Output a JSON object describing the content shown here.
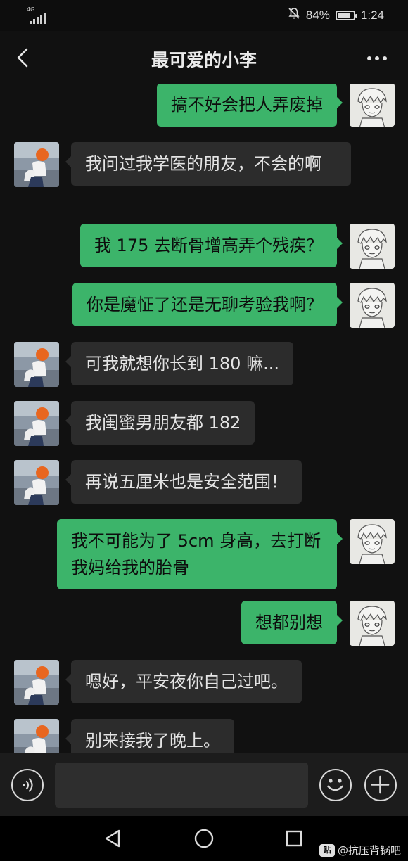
{
  "status_bar": {
    "network": "4G",
    "battery": "84%",
    "battery_level": 0.84,
    "time": "1:24"
  },
  "header": {
    "title": "最可爱的小李"
  },
  "messages": [
    {
      "side": "right",
      "text": "搞不好会把人弄废掉"
    },
    {
      "side": "left",
      "text": "我问过我学医的朋友，不会的啊"
    },
    {
      "side": "right",
      "text": "我 175 去断骨增高弄个残疾？"
    },
    {
      "side": "right",
      "text": "你是魔怔了还是无聊考验我啊？"
    },
    {
      "side": "left",
      "text": "可我就想你长到 180 嘛..."
    },
    {
      "side": "left",
      "text": "我闺蜜男朋友都 182"
    },
    {
      "side": "left",
      "text": "再说五厘米也是安全范围！"
    },
    {
      "side": "right",
      "text": "我不可能为了 5cm 身高，去打断我妈给我的胎骨"
    },
    {
      "side": "right",
      "text": "想都别想"
    },
    {
      "side": "left",
      "text": "嗯好，平安夜你自己过吧。"
    },
    {
      "side": "left",
      "text": "别来接我了晚上。"
    }
  ],
  "input": {
    "value": "",
    "placeholder": ""
  },
  "watermark": {
    "badge": "贴",
    "text": "@抗压背锅吧"
  },
  "colors": {
    "sent_bubble": "#3cb46a",
    "received_bubble": "#2c2c2c",
    "background": "#111111"
  }
}
